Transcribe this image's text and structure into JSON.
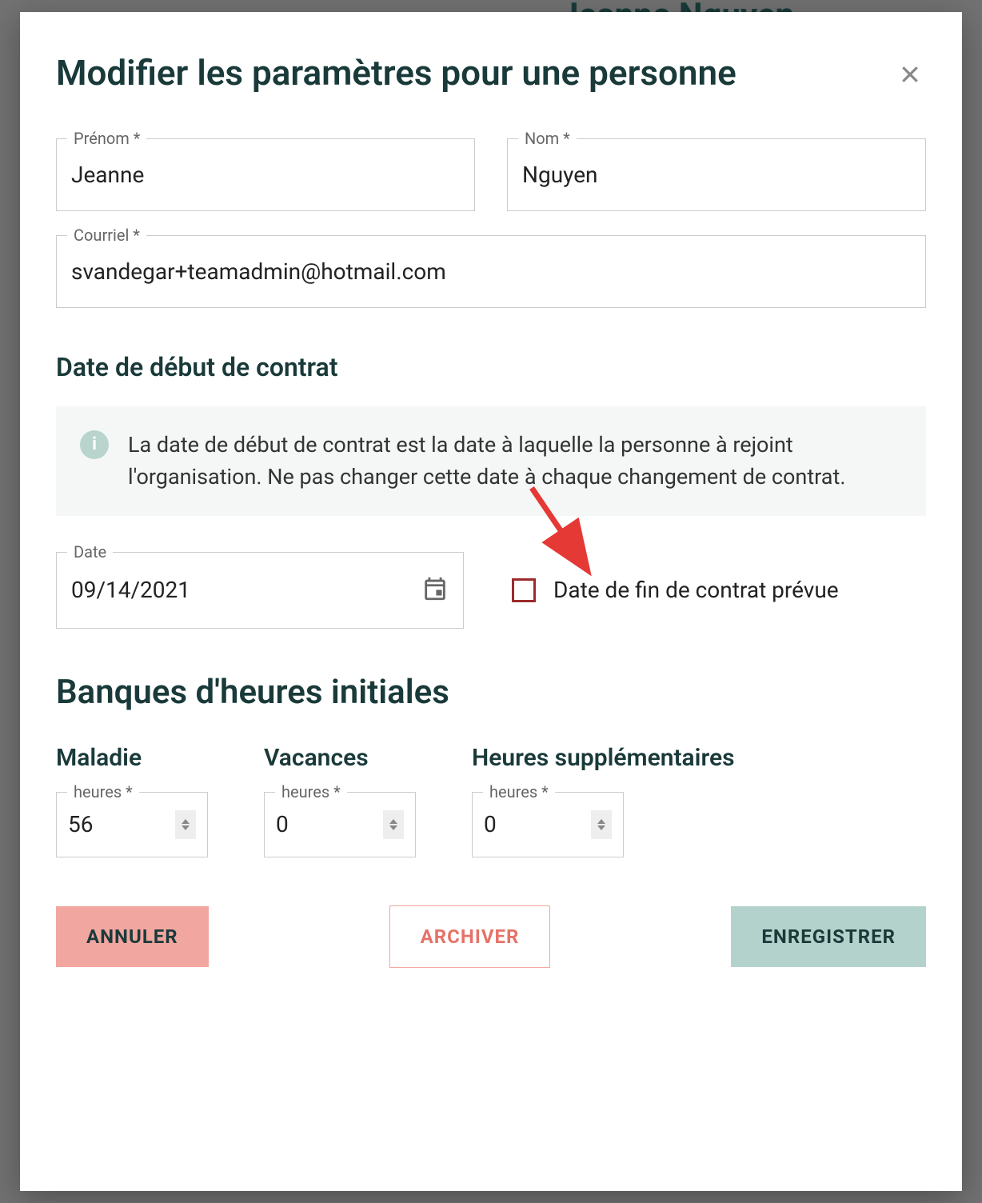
{
  "backdrop": {
    "person_name": "Jeanne Nguyen"
  },
  "modal": {
    "title": "Modifier les paramètres pour une personne"
  },
  "fields": {
    "firstname_label": "Prénom *",
    "firstname_value": "Jeanne",
    "lastname_label": "Nom *",
    "lastname_value": "Nguyen",
    "email_label": "Courriel *",
    "email_value": "svandegar+teamadmin@hotmail.com"
  },
  "contract": {
    "section_title": "Date de début de contrat",
    "info_text": "La date de début de contrat est la date à laquelle la personne à rejoint l'organisation. Ne pas changer cette date à chaque changement de contrat.",
    "date_label": "Date",
    "date_value": "09/14/2021",
    "end_checkbox_label": "Date de fin de contrat prévue"
  },
  "banks": {
    "section_title": "Banques d'heures initiales",
    "hours_label": "heures *",
    "sick": {
      "label": "Maladie",
      "value": "56"
    },
    "vacation": {
      "label": "Vacances",
      "value": "0"
    },
    "overtime": {
      "label": "Heures supplémentaires",
      "value": "0"
    }
  },
  "actions": {
    "cancel": "ANNULER",
    "archive": "ARCHIVER",
    "save": "ENREGISTRER"
  }
}
